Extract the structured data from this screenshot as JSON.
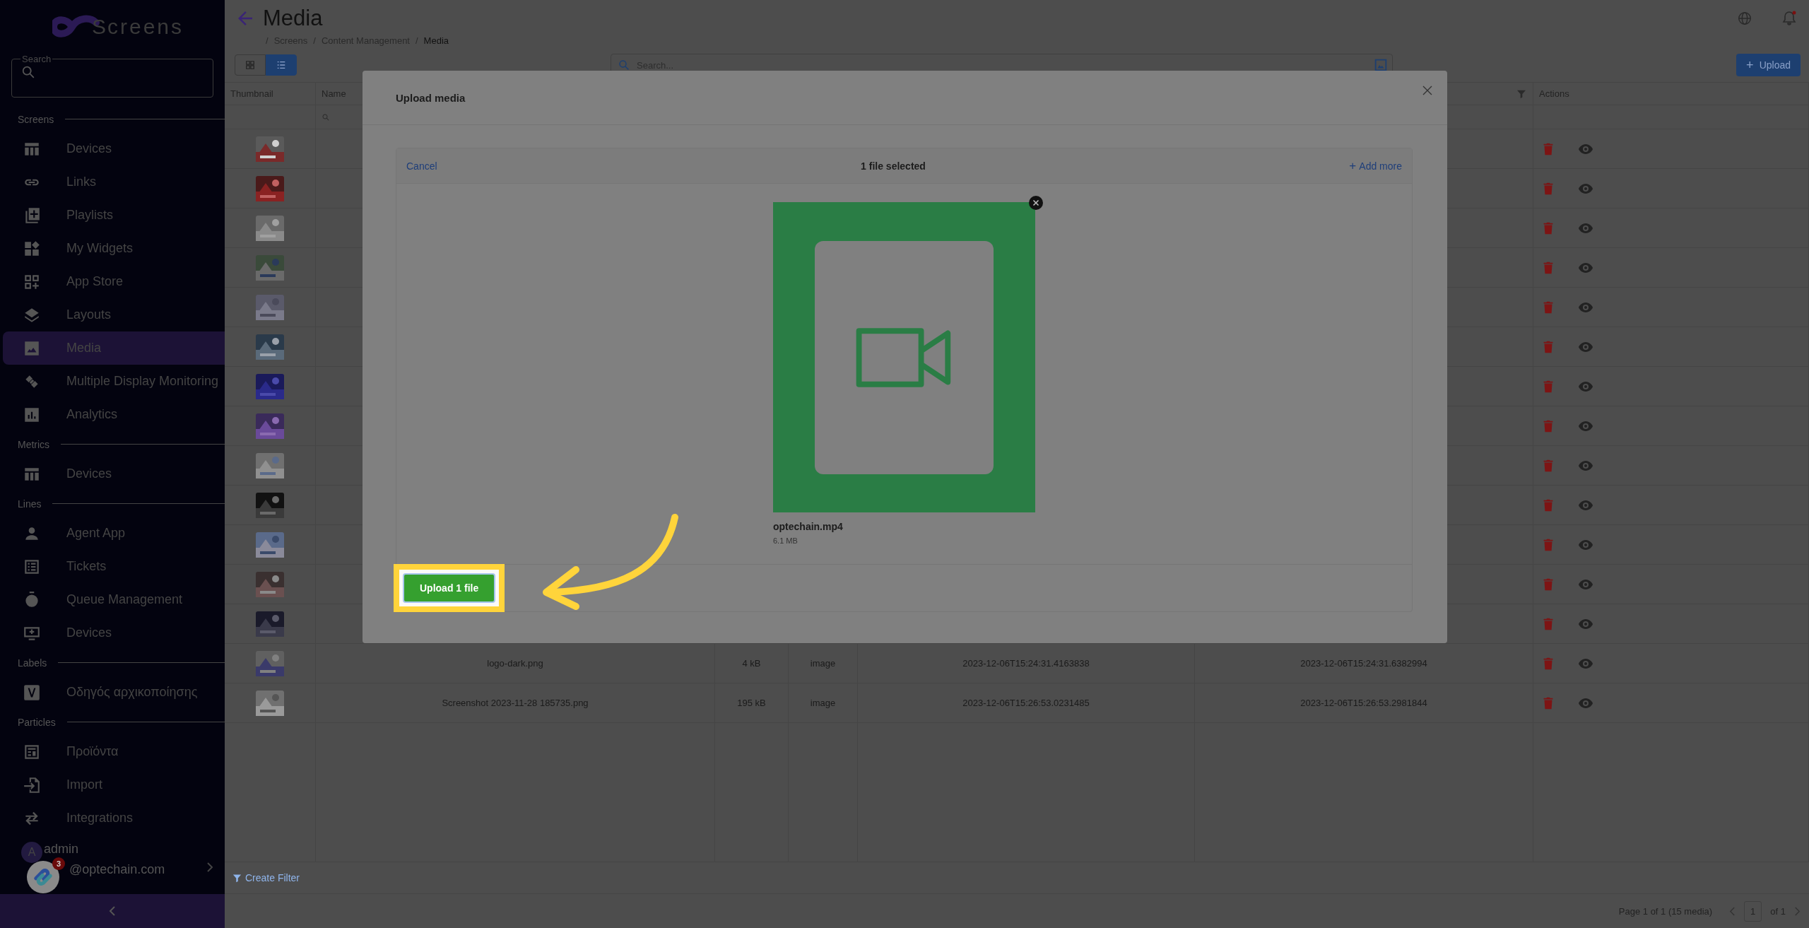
{
  "sidebar": {
    "logo": {
      "mark": "S",
      "text": "creens"
    },
    "search": {
      "label": "Search"
    },
    "sections": [
      {
        "title": "Screens",
        "items": [
          {
            "label": "Devices",
            "selected": false
          },
          {
            "label": "Links",
            "selected": false
          },
          {
            "label": "Playlists",
            "selected": false
          },
          {
            "label": "My Widgets",
            "selected": false
          },
          {
            "label": "App Store",
            "selected": false
          },
          {
            "label": "Layouts",
            "selected": false
          },
          {
            "label": "Media",
            "selected": true
          },
          {
            "label": "Multiple Display Monitoring",
            "selected": false
          },
          {
            "label": "Analytics",
            "selected": false
          }
        ]
      },
      {
        "title": "Metrics",
        "items": [
          {
            "label": "Devices",
            "selected": false
          }
        ]
      },
      {
        "title": "Lines",
        "items": [
          {
            "label": "Agent App",
            "selected": false
          },
          {
            "label": "Tickets",
            "selected": false
          },
          {
            "label": "Queue Management",
            "selected": false
          },
          {
            "label": "Devices",
            "selected": false
          }
        ]
      },
      {
        "title": "Labels",
        "items": [
          {
            "label": "Οδηγός αρχικοποίησης",
            "selected": false
          }
        ]
      },
      {
        "title": "Particles",
        "items": [
          {
            "label": "Προϊόντα",
            "selected": false
          },
          {
            "label": "Import",
            "selected": false
          },
          {
            "label": "Integrations",
            "selected": false
          }
        ]
      }
    ],
    "user": {
      "initial": "A",
      "name": "admin",
      "email": "@optechain.com"
    },
    "chat_widget": {
      "badge": "3"
    }
  },
  "header": {
    "title": "Media",
    "breadcrumb_separator": "/",
    "breadcrumb": [
      "Screens",
      "Content Management",
      "Media"
    ]
  },
  "toolbar": {
    "views": [
      {
        "selected": false
      },
      {
        "selected": true
      }
    ],
    "search": {
      "placeholder": "Search..."
    },
    "upload_button": {
      "icon": "+",
      "label": "Upload"
    }
  },
  "table": {
    "columns": [
      "Thumbnail",
      "Name",
      "Actions"
    ],
    "rows": [
      {
        "kind": "picture"
      },
      {
        "kind": "picture"
      },
      {
        "kind": "picture"
      },
      {
        "kind": "picture"
      },
      {
        "kind": "picture"
      },
      {
        "kind": "picture"
      },
      {
        "kind": "picture"
      },
      {
        "kind": "picture"
      },
      {
        "kind": "picture"
      },
      {
        "kind": "picture"
      },
      {
        "kind": "picture"
      },
      {
        "kind": "picture"
      },
      {
        "kind": "picture"
      },
      {
        "kind": "picture",
        "name": "logo-dark.png",
        "size": "4 kB",
        "type": "image",
        "created": "2023-12-06T15:24:31.4163838",
        "updated": "2023-12-06T15:24:31.6382994"
      },
      {
        "kind": "picture",
        "name": "Screenshot 2023-11-28 185735.png",
        "size": "195 kB",
        "type": "image",
        "created": "2023-12-06T15:26:53.0231485",
        "updated": "2023-12-06T15:26:53.2981844"
      }
    ]
  },
  "filter_bar": {
    "label": "Create Filter"
  },
  "pagination": {
    "summary": "Page 1 of 1 (15 media)",
    "page": "1",
    "total": "of 1"
  },
  "modal": {
    "title": "Upload media",
    "cancel": "Cancel",
    "status": "1 file selected",
    "add_more_icon": "+",
    "add_more": "Add more",
    "file": {
      "name": "optechain.mp4",
      "size": "6.1 MB"
    },
    "upload_button": "Upload 1 file",
    "highlighted": true
  }
}
